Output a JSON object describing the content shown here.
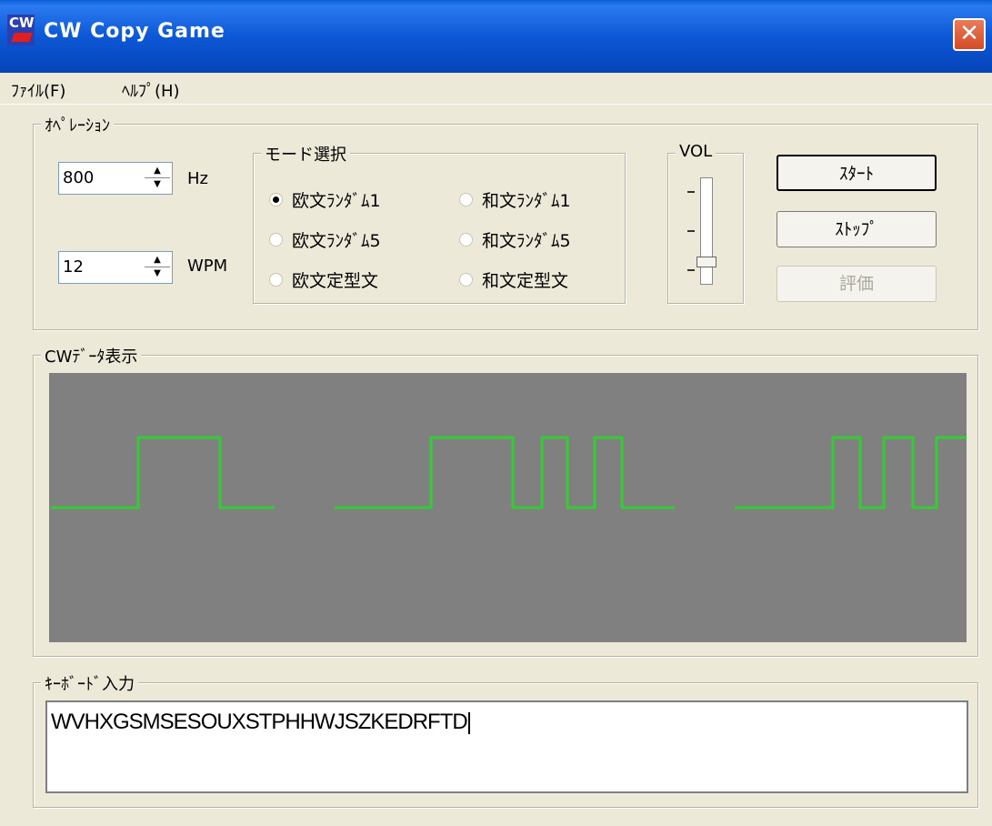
{
  "window": {
    "title": "CW Copy Game",
    "icon_label": "CW",
    "close_glyph": "✕"
  },
  "menu": [
    {
      "label": "ﾌｧｲﾙ(F)"
    },
    {
      "label": "ﾍﾙﾌﾟ(H)"
    }
  ],
  "operation": {
    "group_label": "ｵﾍﾟﾚｰｼｮﾝ",
    "frequency": {
      "value": "800",
      "unit": "Hz"
    },
    "speed": {
      "value": "12",
      "unit": "WPM"
    }
  },
  "mode": {
    "group_label": "モード選択",
    "options": [
      {
        "label": "欧文ﾗﾝﾀﾞﾑ1",
        "selected": true
      },
      {
        "label": "欧文ﾗﾝﾀﾞﾑ5",
        "selected": false
      },
      {
        "label": "欧文定型文",
        "selected": false
      },
      {
        "label": "和文ﾗﾝﾀﾞﾑ1",
        "selected": false
      },
      {
        "label": "和文ﾗﾝﾀﾞﾑ5",
        "selected": false
      },
      {
        "label": "和文定型文",
        "selected": false
      }
    ]
  },
  "volume": {
    "group_label": "VOL",
    "level": 0.15
  },
  "buttons": {
    "start": "ｽﾀｰﾄ",
    "stop": "ｽﾄｯﾌﾟ",
    "evaluate": "評価"
  },
  "cw_display": {
    "group_label": "CWﾃﾞｰﾀ表示",
    "background": "#808080",
    "signal_color": "#33cc33"
  },
  "keyboard_input": {
    "group_label": "ｷｰﾎﾞｰﾄﾞ入力",
    "value": "WVHXGSMSESOUXSTPHHWJSZKEDRFTD"
  },
  "colors": {
    "titlebar": "#0a5fd8",
    "window_bg": "#ece9d8",
    "close_button": "#d44a26"
  }
}
